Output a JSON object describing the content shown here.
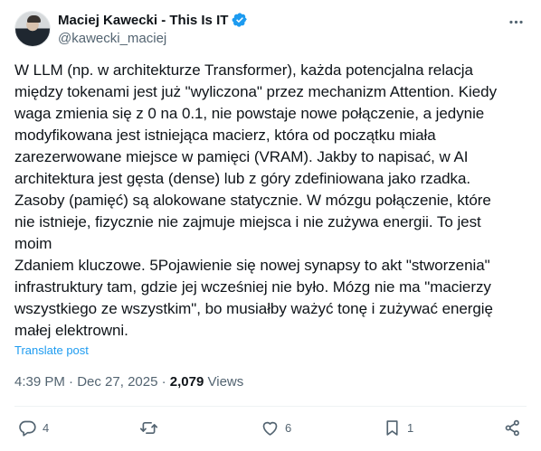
{
  "author": {
    "name": "Maciej Kawecki - This Is IT",
    "handle": "@kawecki_maciej",
    "avatar_icon": "person-photo-avatar",
    "verified_color": "#1d9bf0"
  },
  "post": {
    "text": "W LLM (np. w architekturze Transformer), każda potencjalna relacja\nmiędzy tokenami jest już \"wyliczona\" przez mechanizm Attention. Kiedy\nwaga zmienia się z 0 na 0.1, nie powstaje nowe połączenie, a jedynie\nmodyfikowana jest istniejąca macierz, która od początku miała\nzarezerwowane miejsce w pamięci (VRAM). Jakby to napisać, w AI\narchitektura jest gęsta (dense) lub z góry zdefiniowana jako rzadka.\nZasoby (pamięć) są alokowane statycznie. W mózgu połączenie, które\nnie istnieje, fizycznie nie zajmuje miejsca i nie zużywa energii. To jest\nmoim\nZdaniem kluczowe. 5Pojawienie się nowej synapsy to akt \"stworzenia\"\ninfrastruktury tam, gdzie jej wcześniej nie było. Mózg nie ma \"macierzy\nwszystkiego ze wszystkim\", bo musiałby ważyć tonę i zużywać energię\nmałej elektrowni.",
    "translate_label": "Translate post",
    "time": "4:39 PM",
    "separator": "·",
    "date": "Dec 27, 2025",
    "views_count": "2,079",
    "views_label": "Views"
  },
  "actions": {
    "replies": "4",
    "reposts": "",
    "likes": "6",
    "bookmarks": "1",
    "icons": [
      "reply-icon",
      "repost-icon",
      "like-icon",
      "bookmark-icon",
      "share-icon"
    ]
  },
  "colors": {
    "text": "#0f1419",
    "secondary": "#536471",
    "link": "#1d9bf0",
    "divider": "#eff3f4"
  }
}
